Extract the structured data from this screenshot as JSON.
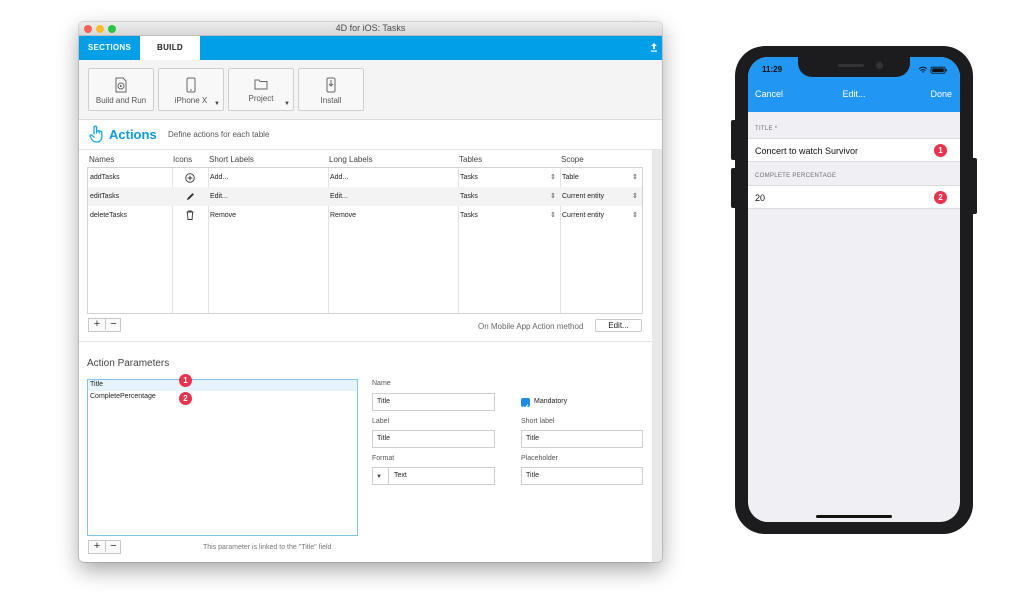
{
  "window": {
    "title": "4D for iOS: Tasks"
  },
  "tabs": {
    "sections": "SECTIONS",
    "build": "BUILD"
  },
  "toolbar": {
    "build_run": "Build and Run",
    "device": "iPhone X",
    "project": "Project",
    "install": "Install"
  },
  "actions": {
    "title": "Actions",
    "subtitle": "Define actions for each table",
    "columns": [
      "Names",
      "Icons",
      "Short Labels",
      "Long Labels",
      "Tables",
      "Scope"
    ],
    "rows": [
      {
        "name": "addTasks",
        "icon": "plus-circle-icon",
        "short": "Add...",
        "long": "Add...",
        "table": "Tasks",
        "scope": "Table"
      },
      {
        "name": "editTasks",
        "icon": "pencil-icon",
        "short": "Edit...",
        "long": "Edit...",
        "table": "Tasks",
        "scope": "Current entity"
      },
      {
        "name": "deleteTasks",
        "icon": "trash-icon",
        "short": "Remove",
        "long": "Remove",
        "table": "Tasks",
        "scope": "Current entity"
      }
    ],
    "method_label": "On Mobile App Action method",
    "method_button": "Edit..."
  },
  "params": {
    "title": "Action Parameters",
    "items": [
      "Title",
      "CompletePercentage"
    ],
    "badges": [
      "1",
      "2"
    ],
    "name_label": "Name",
    "name_value": "Title",
    "mandatory_label": "Mandatory",
    "mandatory_checked": true,
    "label_label": "Label",
    "label_value": "Title",
    "short_label_label": "Short label",
    "short_label_value": "Title",
    "format_label": "Format",
    "format_value": "Text",
    "placeholder_label": "Placeholder",
    "placeholder_value": "Title",
    "link_note": "This parameter is linked to the \"Title\" field"
  },
  "phone": {
    "time": "11:29",
    "cancel": "Cancel",
    "title": "Edit...",
    "done": "Done",
    "field1_header": "TITLE *",
    "field1_value": "Concert to watch Survivor",
    "field2_header": "COMPLETE PERCENTAGE",
    "field2_value": "20"
  },
  "colors": {
    "accent": "#009fe8",
    "badge": "#e8334d",
    "phone_nav": "#2196f3"
  }
}
